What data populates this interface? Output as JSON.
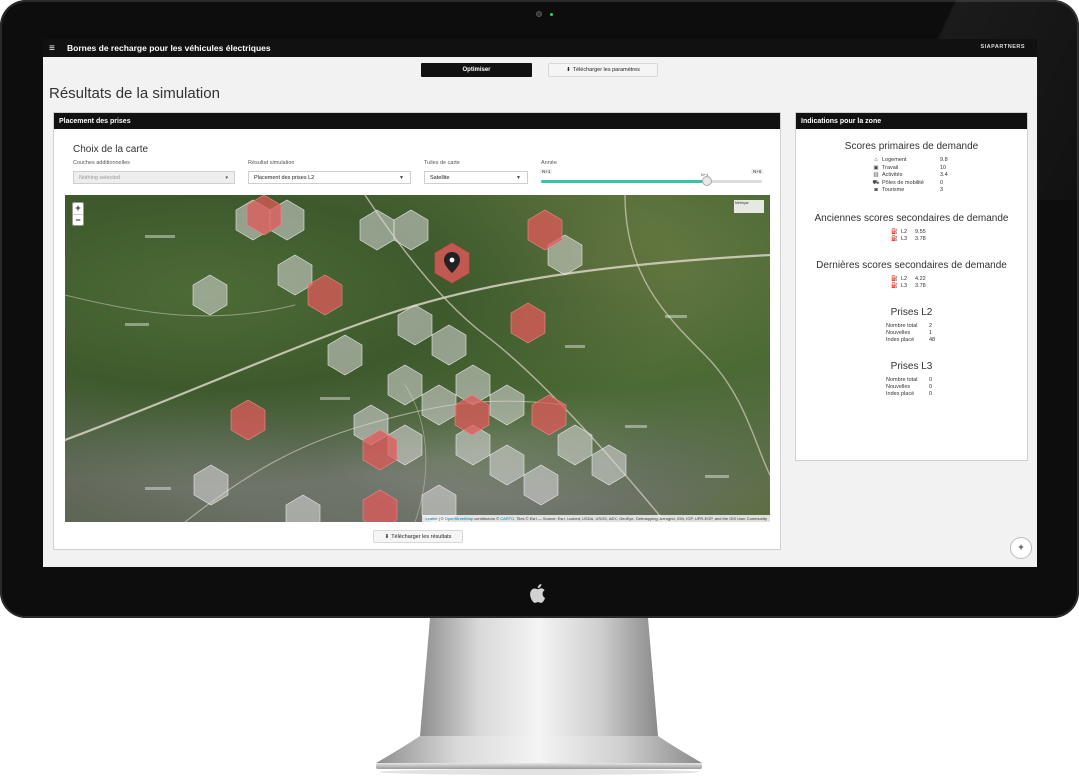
{
  "app": {
    "title": "Bornes de recharge pour les véhicules électriques",
    "brand": "SIAPARTNERS"
  },
  "toolbar": {
    "optimize_label": "Optimiser",
    "download_params_label": "Télécharger les paramètres"
  },
  "page": {
    "title": "Résultats de la simulation"
  },
  "left_panel": {
    "header": "Placement des prises",
    "map_section_title": "Choix de la carte",
    "layers": {
      "label": "Couches additionnelles",
      "value": "Nothing selected"
    },
    "sim_result": {
      "label": "Résultat simulation",
      "value": "Placement des prises L2"
    },
    "tiles": {
      "label": "Tuiles de carte",
      "value": "Satellite"
    },
    "year": {
      "label": "Année",
      "min_label": "N+1",
      "max_label": "N+6",
      "value_label": "N+4",
      "fraction": 0.75
    },
    "map": {
      "zoom_in": "+",
      "zoom_out": "−",
      "legend": "Métrique",
      "attribution_link1": "Leaflet",
      "attribution_text1": " | © ",
      "attribution_link2": "OpenStreetMap",
      "attribution_text2": " contributors © ",
      "attribution_link3": "CARTO",
      "attribution_text3": ", Tiles © Esri — Source: Esri, i-cubed, USDA, USGS, AEX, GeoEye, Getmapping, Aerogrid, IGN, IGP, UPR-EGP, and the GIS User Community"
    },
    "download_results_label": "Télécharger les résultats"
  },
  "right_panel": {
    "header": "Indications pour la zone",
    "primary": {
      "title": "Scores primaires de demande",
      "rows": [
        {
          "icon": "home-icon",
          "glyph": "⌂",
          "label": "Logement",
          "value": "9.8"
        },
        {
          "icon": "briefcase-icon",
          "glyph": "▣",
          "label": "Travail",
          "value": "10"
        },
        {
          "icon": "building-icon",
          "glyph": "▥",
          "label": "Activités",
          "value": "3.4"
        },
        {
          "icon": "car-icon",
          "glyph": "⛟",
          "label": "Pôles de mobilité",
          "value": "0"
        },
        {
          "icon": "camera-icon",
          "glyph": "◙",
          "label": "Tourisme",
          "value": "3"
        }
      ]
    },
    "old_secondary": {
      "title": "Anciennes scores secondaires de demande",
      "rows": [
        {
          "glyph": "⛽",
          "label": "L2",
          "value": "9.55"
        },
        {
          "glyph": "⛽",
          "label": "L3",
          "value": "3.78"
        }
      ]
    },
    "new_secondary": {
      "title": "Dernières scores secondaires de demande",
      "rows": [
        {
          "glyph": "⛽",
          "label": "L2",
          "value": "4.22"
        },
        {
          "glyph": "⛽",
          "label": "L3",
          "value": "3.78"
        }
      ]
    },
    "prises_l2": {
      "title": "Prises L2",
      "rows": [
        {
          "label": "Nombre total",
          "value": "2"
        },
        {
          "label": "Nouvelles",
          "value": "1"
        },
        {
          "label": "Index placé",
          "value": "48"
        }
      ]
    },
    "prises_l3": {
      "title": "Prises L3",
      "rows": [
        {
          "label": "Nombre total",
          "value": "0"
        },
        {
          "label": "Nouvelles",
          "value": "0"
        },
        {
          "label": "Index placé",
          "value": "0"
        }
      ]
    }
  },
  "help": {
    "label": "+"
  },
  "colors": {
    "navbar": "#111111",
    "accent_slider": "#36c3a8",
    "hex_red": "#e05a5a",
    "hex_grey": "#cfcfcf"
  }
}
